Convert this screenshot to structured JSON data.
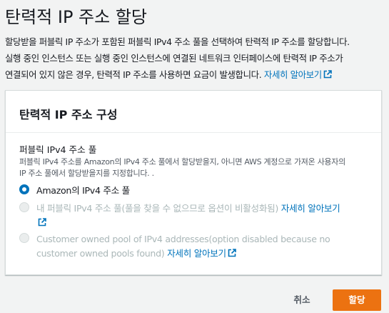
{
  "page": {
    "title": "탄력적 IP 주소 할당",
    "intro_line1": "할당받을 퍼블릭 IP 주소가 포함된 퍼블릭 IPv4 주소 풀을 선택하여 탄력적 IP 주소를 할당합니다.",
    "intro_line2": "실행 중인 인스턴스 또는 실행 중인 인스턴스에 연결된 네트워크 인터페이스에 탄력적 IP 주소가",
    "intro_line3": "연결되어 있지 않은 경우, 탄력적 IP 주소를 사용하면 요금이 발생합니다.",
    "learn_more": "자세히 알아보기"
  },
  "config": {
    "title": "탄력적 IP 주소 구성",
    "pool_label": "퍼블릭 IPv4 주소 풀",
    "pool_desc_line1": "퍼블릭 IPv4 주소를 Amazon의 IPv4 주소 풀에서 할당받을지, 아니면 AWS 계정으로 가져온 사용자의",
    "pool_desc_line2": "IP 주소 풀에서 할당받을지를 지정합니다. .",
    "options": [
      {
        "label": "Amazon의 IPv4 주소 풀",
        "selected": true,
        "disabled": false
      },
      {
        "label": "내 퍼블릭 IPv4 주소 풀(풀을 찾을 수 없으므로 옵션이 비활성화됨)",
        "link": "자세히 알아보기",
        "selected": false,
        "disabled": true
      },
      {
        "label_line1": "Customer owned pool of IPv4 addresses(option disabled because no",
        "label_line2": "customer owned pools found)",
        "link": "자세히 알아보기",
        "selected": false,
        "disabled": true
      }
    ]
  },
  "footer": {
    "cancel_label": "취소",
    "allocate_label": "할당"
  },
  "colors": {
    "background": "#f2f3f3",
    "link": "#0073bb",
    "primary_button": "#ec7211",
    "disabled_text": "#aab7b8"
  },
  "icons": {
    "external_link": "external-link-icon"
  }
}
